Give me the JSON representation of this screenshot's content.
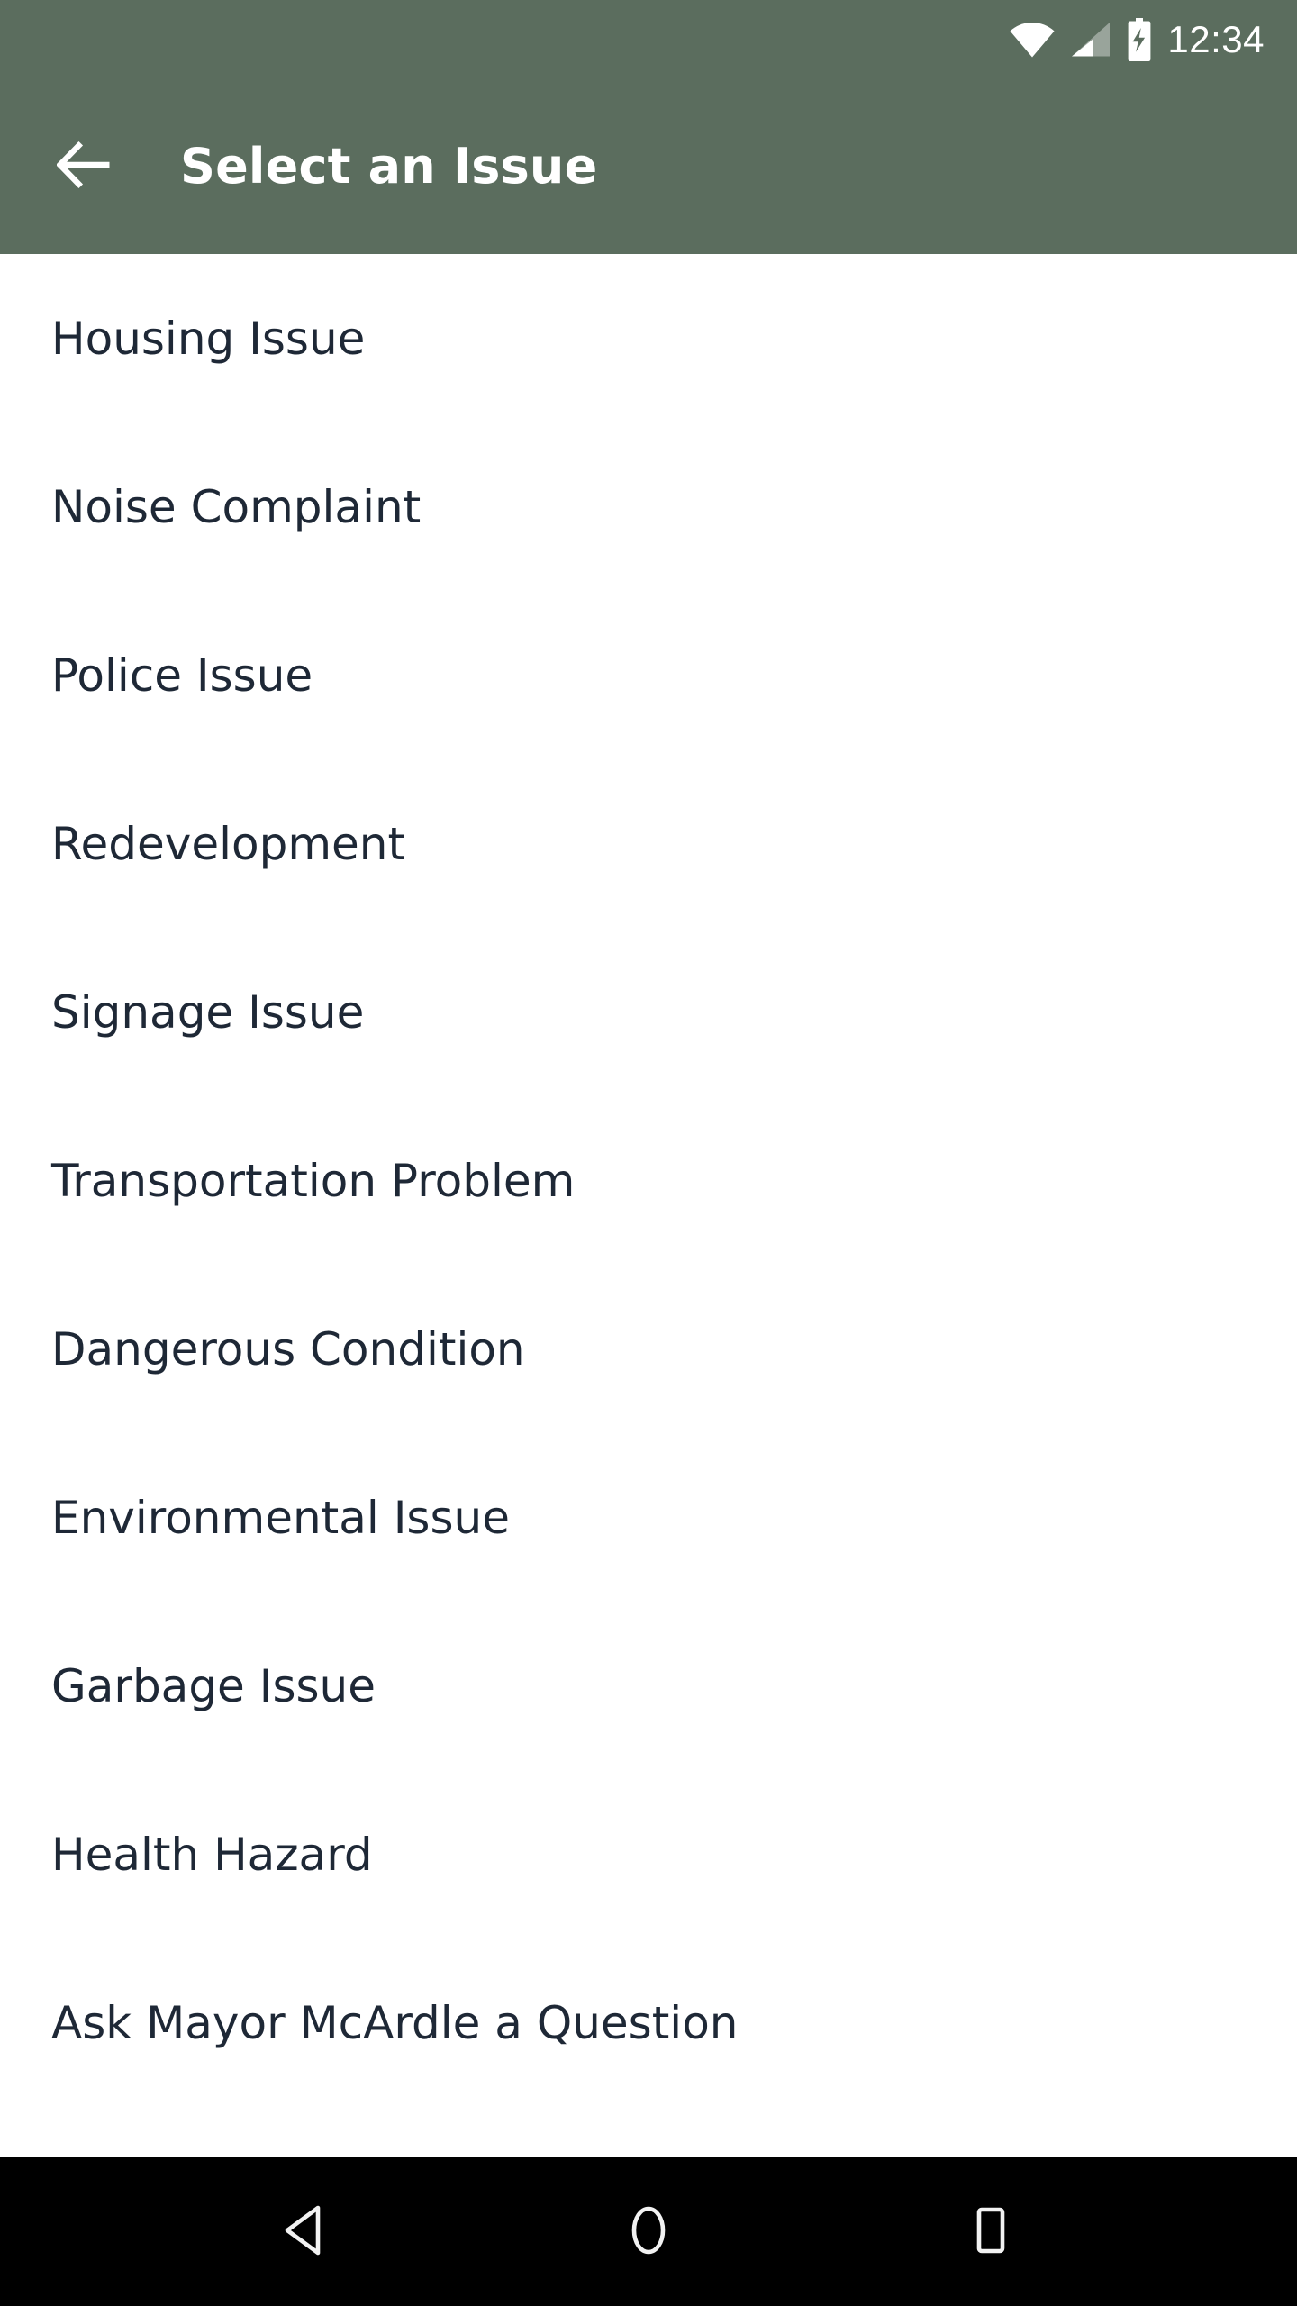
{
  "status_bar": {
    "time": "12:34",
    "icons": [
      {
        "name": "wifi-icon",
        "label": "wifi"
      },
      {
        "name": "cellular-signal-icon",
        "label": "cellular signal"
      },
      {
        "name": "battery-charging-icon",
        "label": "battery charging"
      }
    ],
    "background_color": "#5B6D5E",
    "foreground_color": "#FFFFFF"
  },
  "app_bar": {
    "title": "Select an Issue",
    "back_icon": "arrow-left-icon",
    "background_color": "#5B6D5E",
    "title_color": "#FFFFFF"
  },
  "list": {
    "background_color": "#FFFFFF",
    "text_color": "#1E2836",
    "items": [
      {
        "label": "Housing Issue"
      },
      {
        "label": "Noise Complaint"
      },
      {
        "label": "Police Issue"
      },
      {
        "label": "Redevelopment"
      },
      {
        "label": "Signage Issue"
      },
      {
        "label": "Transportation Problem"
      },
      {
        "label": "Dangerous Condition"
      },
      {
        "label": "Environmental Issue"
      },
      {
        "label": "Garbage Issue"
      },
      {
        "label": "Health Hazard"
      },
      {
        "label": "Ask Mayor McArdle a Question"
      }
    ]
  },
  "nav_bar": {
    "background_color": "#000000",
    "buttons": [
      {
        "name": "nav-back-button",
        "icon": "triangle-left-icon"
      },
      {
        "name": "nav-home-button",
        "icon": "circle-icon"
      },
      {
        "name": "nav-recents-button",
        "icon": "square-icon"
      }
    ]
  }
}
